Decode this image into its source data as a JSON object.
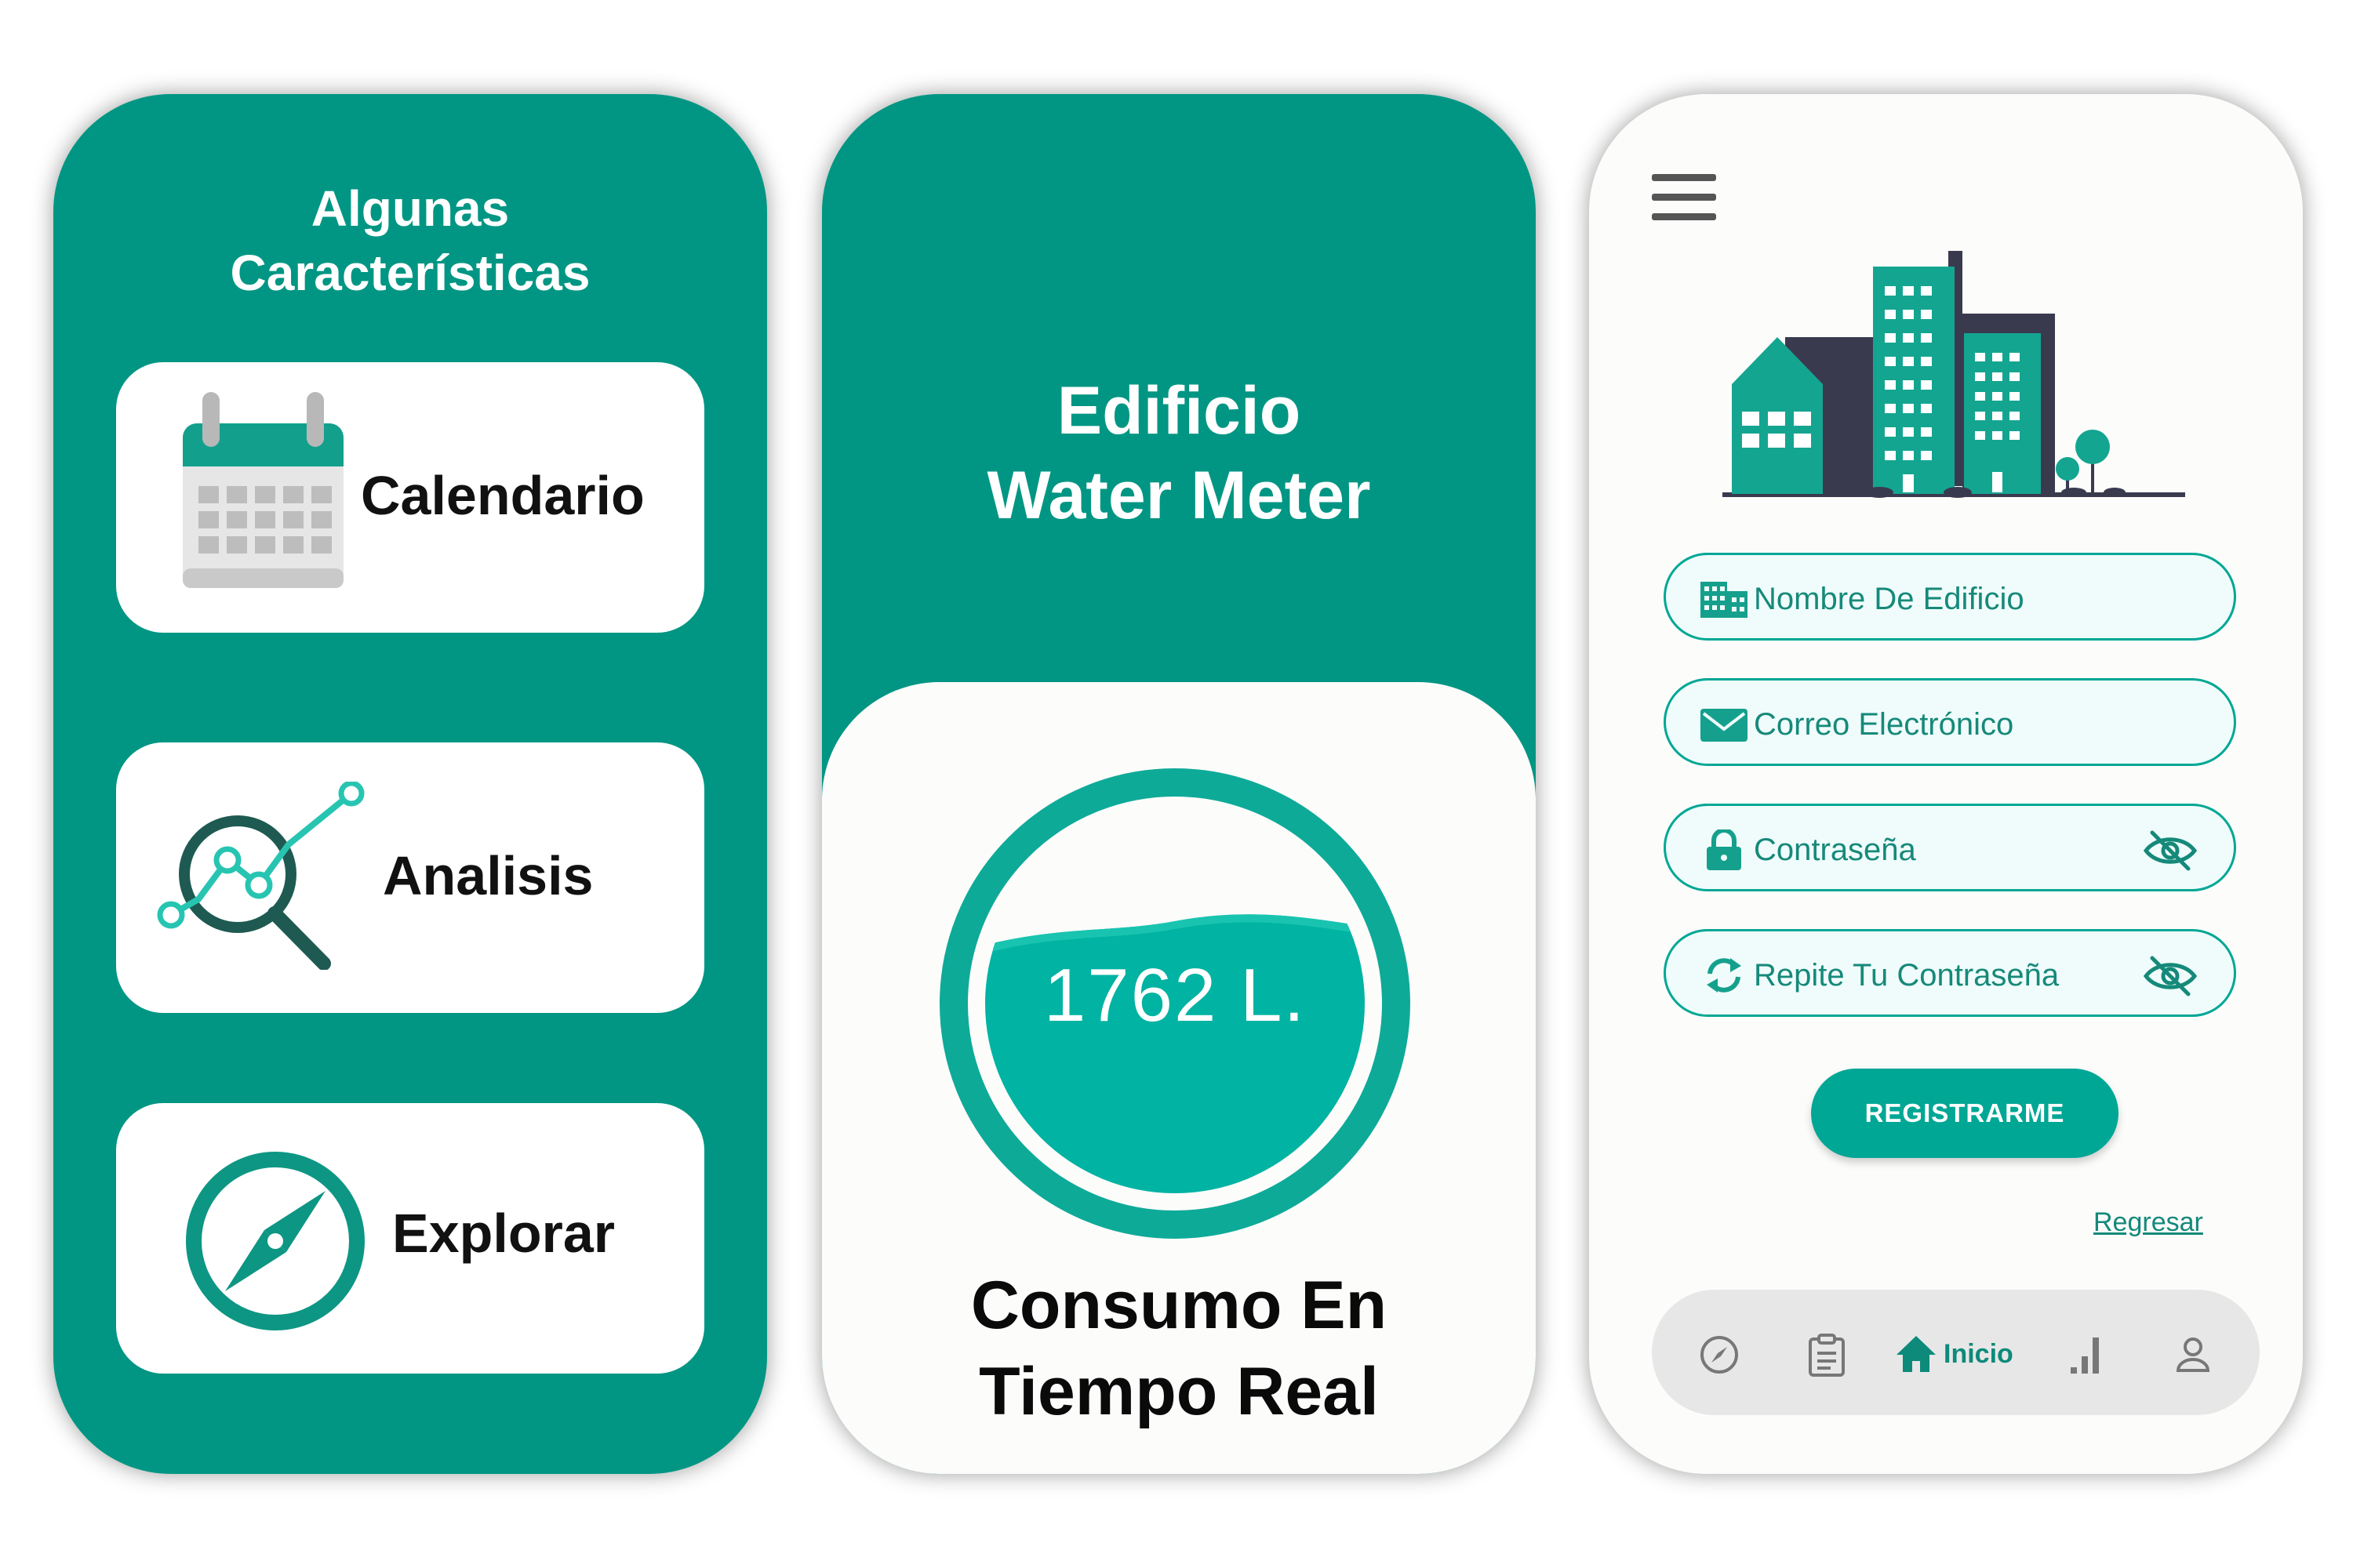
{
  "features_panel": {
    "title_line1": "Algunas",
    "title_line2": "Características",
    "cards": [
      {
        "label": "Calendario",
        "icon": "calendar-icon"
      },
      {
        "label": "Analisis",
        "icon": "analytics-search-icon"
      },
      {
        "label": "Explorar",
        "icon": "compass-icon"
      }
    ]
  },
  "meter_panel": {
    "title_line1": "Edificio",
    "title_line2": "Water Meter",
    "reading": "1762 L.",
    "caption_line1": "Consumo En",
    "caption_line2": "Tiempo Real"
  },
  "register_panel": {
    "menu_icon": "hamburger-menu-icon",
    "illustration": "city-buildings-illustration",
    "fields": [
      {
        "placeholder": "Nombre De Edificio",
        "icon": "building-icon"
      },
      {
        "placeholder": "Correo Electrónico",
        "icon": "mail-icon"
      },
      {
        "placeholder": "Contraseña",
        "icon": "lock-icon",
        "toggle_icon": "eye-off-icon"
      },
      {
        "placeholder": "Repite Tu Contraseña",
        "icon": "refresh-icon",
        "toggle_icon": "eye-off-icon"
      }
    ],
    "register_button": "REGISTRARME",
    "back_link": "Regresar",
    "nav": {
      "items": [
        {
          "icon": "compass-icon"
        },
        {
          "icon": "clipboard-icon"
        },
        {
          "icon": "home-icon",
          "label": "Inicio",
          "active": true
        },
        {
          "icon": "bar-chart-icon"
        },
        {
          "icon": "user-icon"
        }
      ]
    }
  },
  "colors": {
    "brand": "#009683",
    "accent": "#00b3a2",
    "dark": "#3a3a4f"
  }
}
